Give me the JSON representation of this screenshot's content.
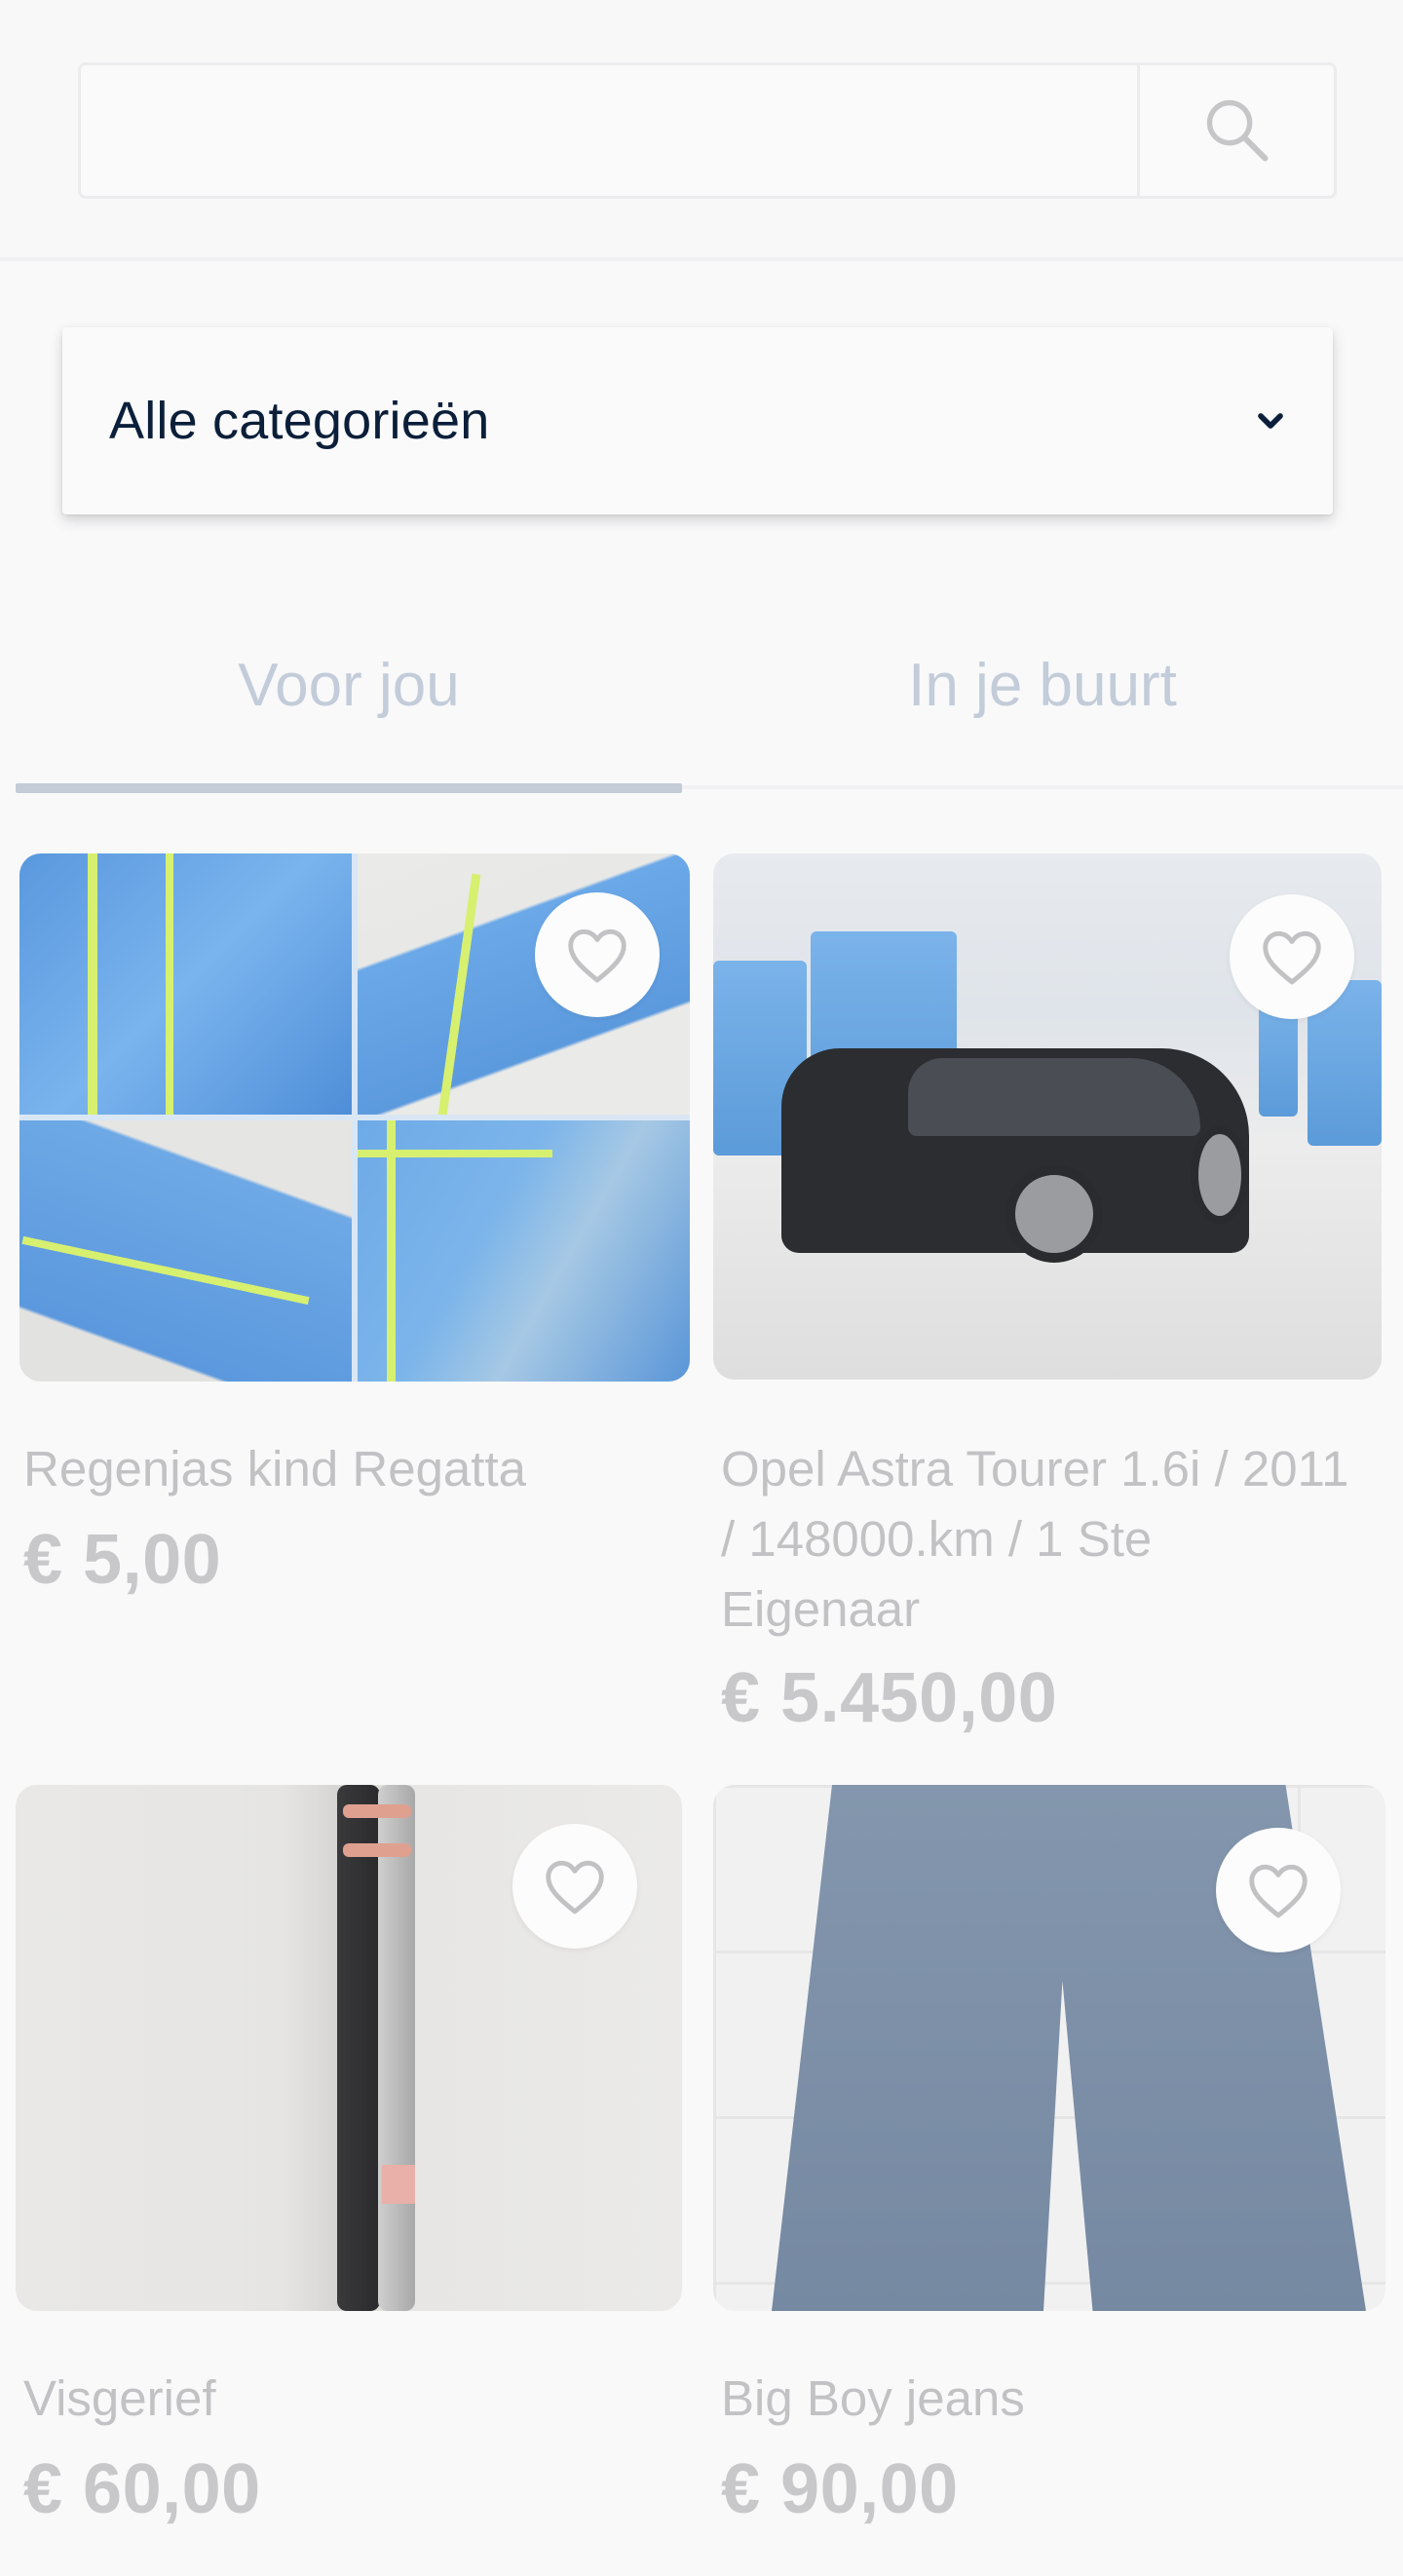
{
  "search": {
    "value": "",
    "placeholder": ""
  },
  "category_select": {
    "selected": "Alle categorieën"
  },
  "tabs": [
    {
      "label": "Voor jou",
      "active": true
    },
    {
      "label": "In je buurt",
      "active": false
    }
  ],
  "products": [
    {
      "title": "Regenjas kind Regatta",
      "price": "€ 5,00",
      "favorited": false
    },
    {
      "title": "Opel Astra Tourer 1.6i / 2011 / 148000.km / 1 Ste Eigenaar",
      "price": "€ 5.450,00",
      "favorited": false
    },
    {
      "title": "Visgerief",
      "price": "€ 60,00",
      "favorited": false
    },
    {
      "title": "Big Boy jeans",
      "price": "€ 90,00",
      "favorited": false
    }
  ],
  "colors": {
    "tab_active": "#c3ccd9",
    "text_dark": "#0b1f3a",
    "faded_text": "#c2c2c4"
  },
  "icons": {
    "search": "search-icon",
    "dropdown": "chevron-down-icon",
    "favorite": "heart-outline-icon"
  }
}
